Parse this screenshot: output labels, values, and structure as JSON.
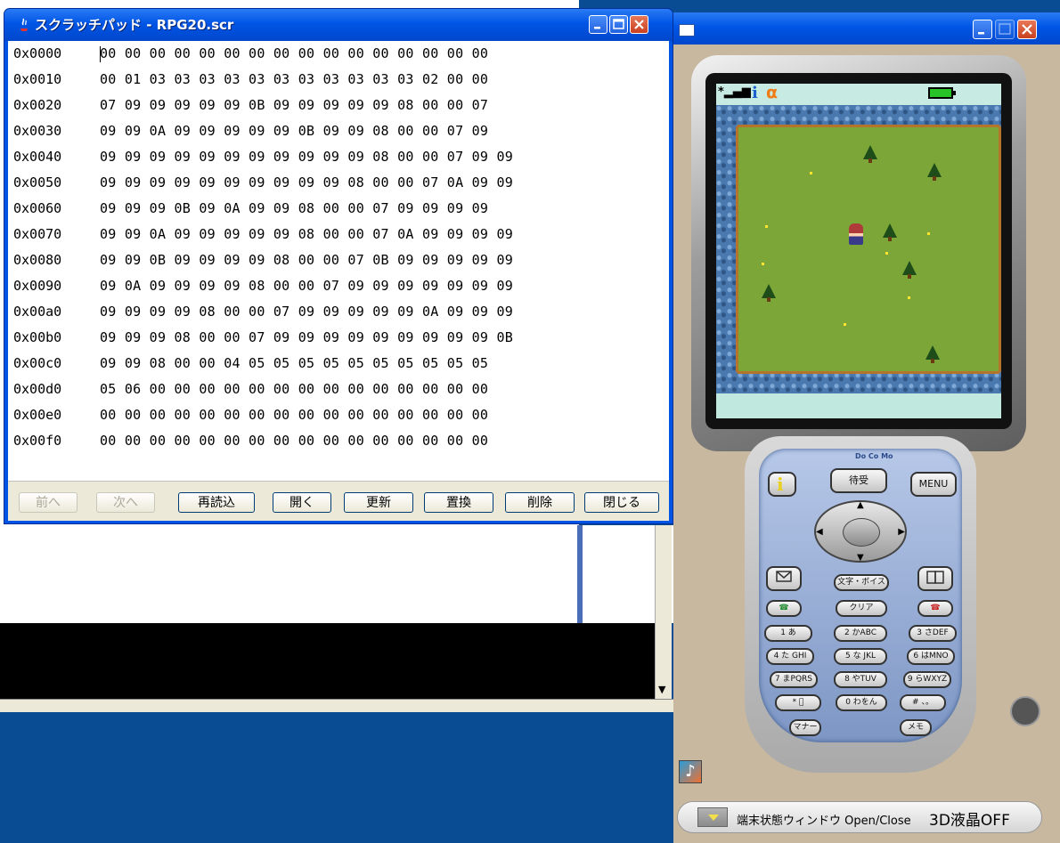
{
  "scratchpad": {
    "title": "スクラッチパッド - RPG20.scr",
    "rows": [
      {
        "addr": "0x0000",
        "data": "00 00 00 00 00 00 00 00 00 00 00 00 00 00 00 00"
      },
      {
        "addr": "0x0010",
        "data": "00 01 03 03 03 03 03 03 03 03 03 03 03 02 00 00"
      },
      {
        "addr": "0x0020",
        "data": "07 09 09 09 09 09 0B 09 09 09 09 09 08 00 00 07"
      },
      {
        "addr": "0x0030",
        "data": "09 09 0A 09 09 09 09 09 0B 09 09 08 00 00 07 09"
      },
      {
        "addr": "0x0040",
        "data": "09 09 09 09 09 09 09 09 09 09 09 08 00 00 07 09 09"
      },
      {
        "addr": "0x0050",
        "data": "09 09 09 09 09 09 09 09 09 09 08 00 00 07 0A 09 09"
      },
      {
        "addr": "0x0060",
        "data": "09 09 09 0B 09 0A 09 09 08 00 00 07 09 09 09 09"
      },
      {
        "addr": "0x0070",
        "data": "09 09 0A 09 09 09 09 09 08 00 00 07 0A 09 09 09 09"
      },
      {
        "addr": "0x0080",
        "data": "09 09 0B 09 09 09 09 08 00 00 07 0B 09 09 09 09 09"
      },
      {
        "addr": "0x0090",
        "data": "09 0A 09 09 09 09 08 00 00 07 09 09 09 09 09 09 09"
      },
      {
        "addr": "0x00a0",
        "data": "09 09 09 09 08 00 00 07 09 09 09 09 09 0A 09 09 09"
      },
      {
        "addr": "0x00b0",
        "data": "09 09 09 08 00 00 07 09 09 09 09 09 09 09 09 09 0B"
      },
      {
        "addr": "0x00c0",
        "data": "09 09 08 00 00 04 05 05 05 05 05 05 05 05 05 05"
      },
      {
        "addr": "0x00d0",
        "data": "05 06 00 00 00 00 00 00 00 00 00 00 00 00 00 00"
      },
      {
        "addr": "0x00e0",
        "data": "00 00 00 00 00 00 00 00 00 00 00 00 00 00 00 00"
      },
      {
        "addr": "0x00f0",
        "data": "00 00 00 00 00 00 00 00 00 00 00 00 00 00 00 00"
      }
    ],
    "buttons": {
      "prev": "前へ",
      "next": "次へ",
      "reload": "再読込",
      "open": "開く",
      "update": "更新",
      "replace": "置換",
      "delete": "削除",
      "close": "閉じる"
    }
  },
  "phone": {
    "brand": "Do Co Mo",
    "keys": {
      "machiuke": "待受",
      "menu": "MENU",
      "moji_voice": "文字・ボイス",
      "clear": "クリア",
      "k1": "1 あ",
      "k2": "2 かABC",
      "k3": "3 さDEF",
      "k4": "4 た GHI",
      "k5": "5 な JKL",
      "k6": "6 はMNO",
      "k7": "7 まPQRS",
      "k8": "8 やTUV",
      "k9": "9 らWXYZ",
      "kstar": "* ﾟ",
      "k0": "0 わをん",
      "khash": "# 、。",
      "manner": "マナー",
      "memo": "メモ"
    },
    "status_label": "端末状態ウィンドウ Open/Close",
    "lcd_label": "3D液晶OFF"
  },
  "colors": {
    "xp_title": "#0055e5",
    "grass": "#7ca637",
    "water": "#4a79b0",
    "battery": "#27c227"
  }
}
